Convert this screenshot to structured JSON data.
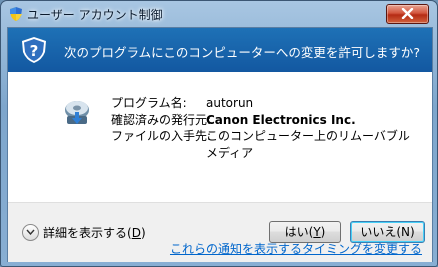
{
  "window": {
    "title": "ユーザー アカウント制御"
  },
  "banner": {
    "question": "次のプログラムにこのコンピューターへの変更を許可しますか?"
  },
  "details": {
    "program_label": "プログラム名:",
    "program_value": "autorun",
    "publisher_label": "確認済みの発行元:",
    "publisher_value": "Canon Electronics Inc.",
    "source_label": "ファイルの入手先:",
    "source_value": "このコンピューター上のリムーバブル メディア"
  },
  "footer": {
    "show_details_label": "詳細を表示する(",
    "show_details_key": "D",
    "show_details_suffix": ")",
    "yes_label": "はい(",
    "yes_key": "Y",
    "yes_suffix": ")",
    "no_label": "いいえ(N)",
    "change_notify_link": "これらの通知を表示するタイミングを変更する"
  }
}
